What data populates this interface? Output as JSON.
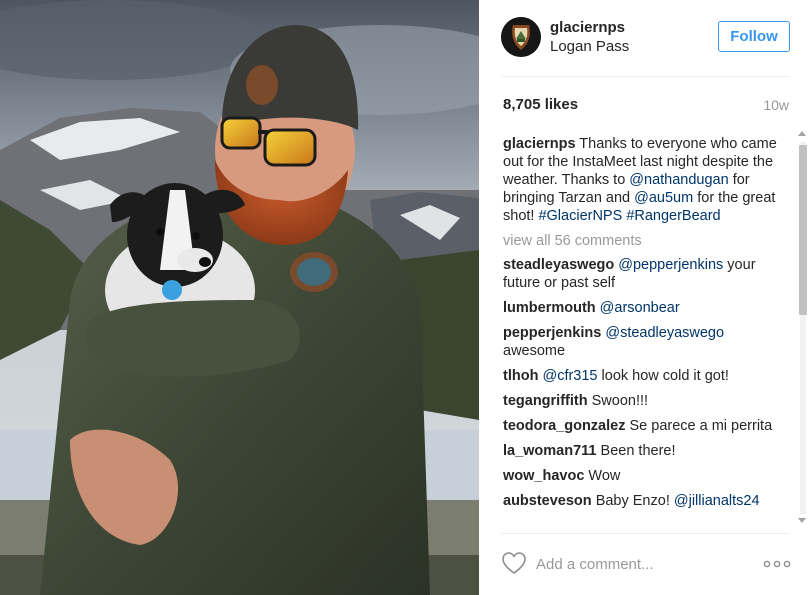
{
  "photo": {
    "icon": "ranger-with-puppy-photo"
  },
  "header": {
    "username": "glaciernps",
    "location": "Logan Pass",
    "follow_label": "Follow",
    "avatar_icon": "nps-arrowhead-logo"
  },
  "likes": "8,705 likes",
  "time_ago": "10w",
  "caption": {
    "username": "glaciernps",
    "text_1": " Thanks to everyone who came out for the InstaMeet last night despite the weather. Thanks to ",
    "mention_1": "@nathandugan",
    "text_2": " for bringing Tarzan and ",
    "mention_2": "@au5um",
    "text_3": " for the great shot! ",
    "hashtag_1": "#GlacierNPS",
    "text_4": " ",
    "hashtag_2": "#RangerBeard"
  },
  "view_all": "view all 56 comments",
  "comments": [
    {
      "username": "steadleyaswego",
      "mention": "@pepperjenkins",
      "text": " your future or past self"
    },
    {
      "username": "lumbermouth",
      "mention": "@arsonbear",
      "text": ""
    },
    {
      "username": "pepperjenkins",
      "mention": "@steadleyaswego",
      "text": " awesome"
    },
    {
      "username": "tlhoh",
      "mention": "@cfr315",
      "text": " look how cold it got!"
    },
    {
      "username": "tegangriffith",
      "mention": "",
      "text": "Swoon!!!"
    },
    {
      "username": "teodora_gonzalez",
      "mention": "",
      "text": "Se parece a mi perrita"
    },
    {
      "username": "la_woman711",
      "mention": "",
      "text": "Been there!"
    },
    {
      "username": "wow_havoc",
      "mention": "",
      "text": "Wow"
    },
    {
      "username": "aubsteveson",
      "mention": "@jillianalts24",
      "text": "",
      "prefix": "Baby Enzo! "
    }
  ],
  "footer": {
    "add_comment_placeholder": "Add a comment...",
    "heart_icon": "heart-outline-icon",
    "more_icon": "more-options-icon"
  },
  "colors": {
    "link": "#003569",
    "follow_blue": "#3897f0",
    "muted": "#999999",
    "text": "#262626"
  }
}
